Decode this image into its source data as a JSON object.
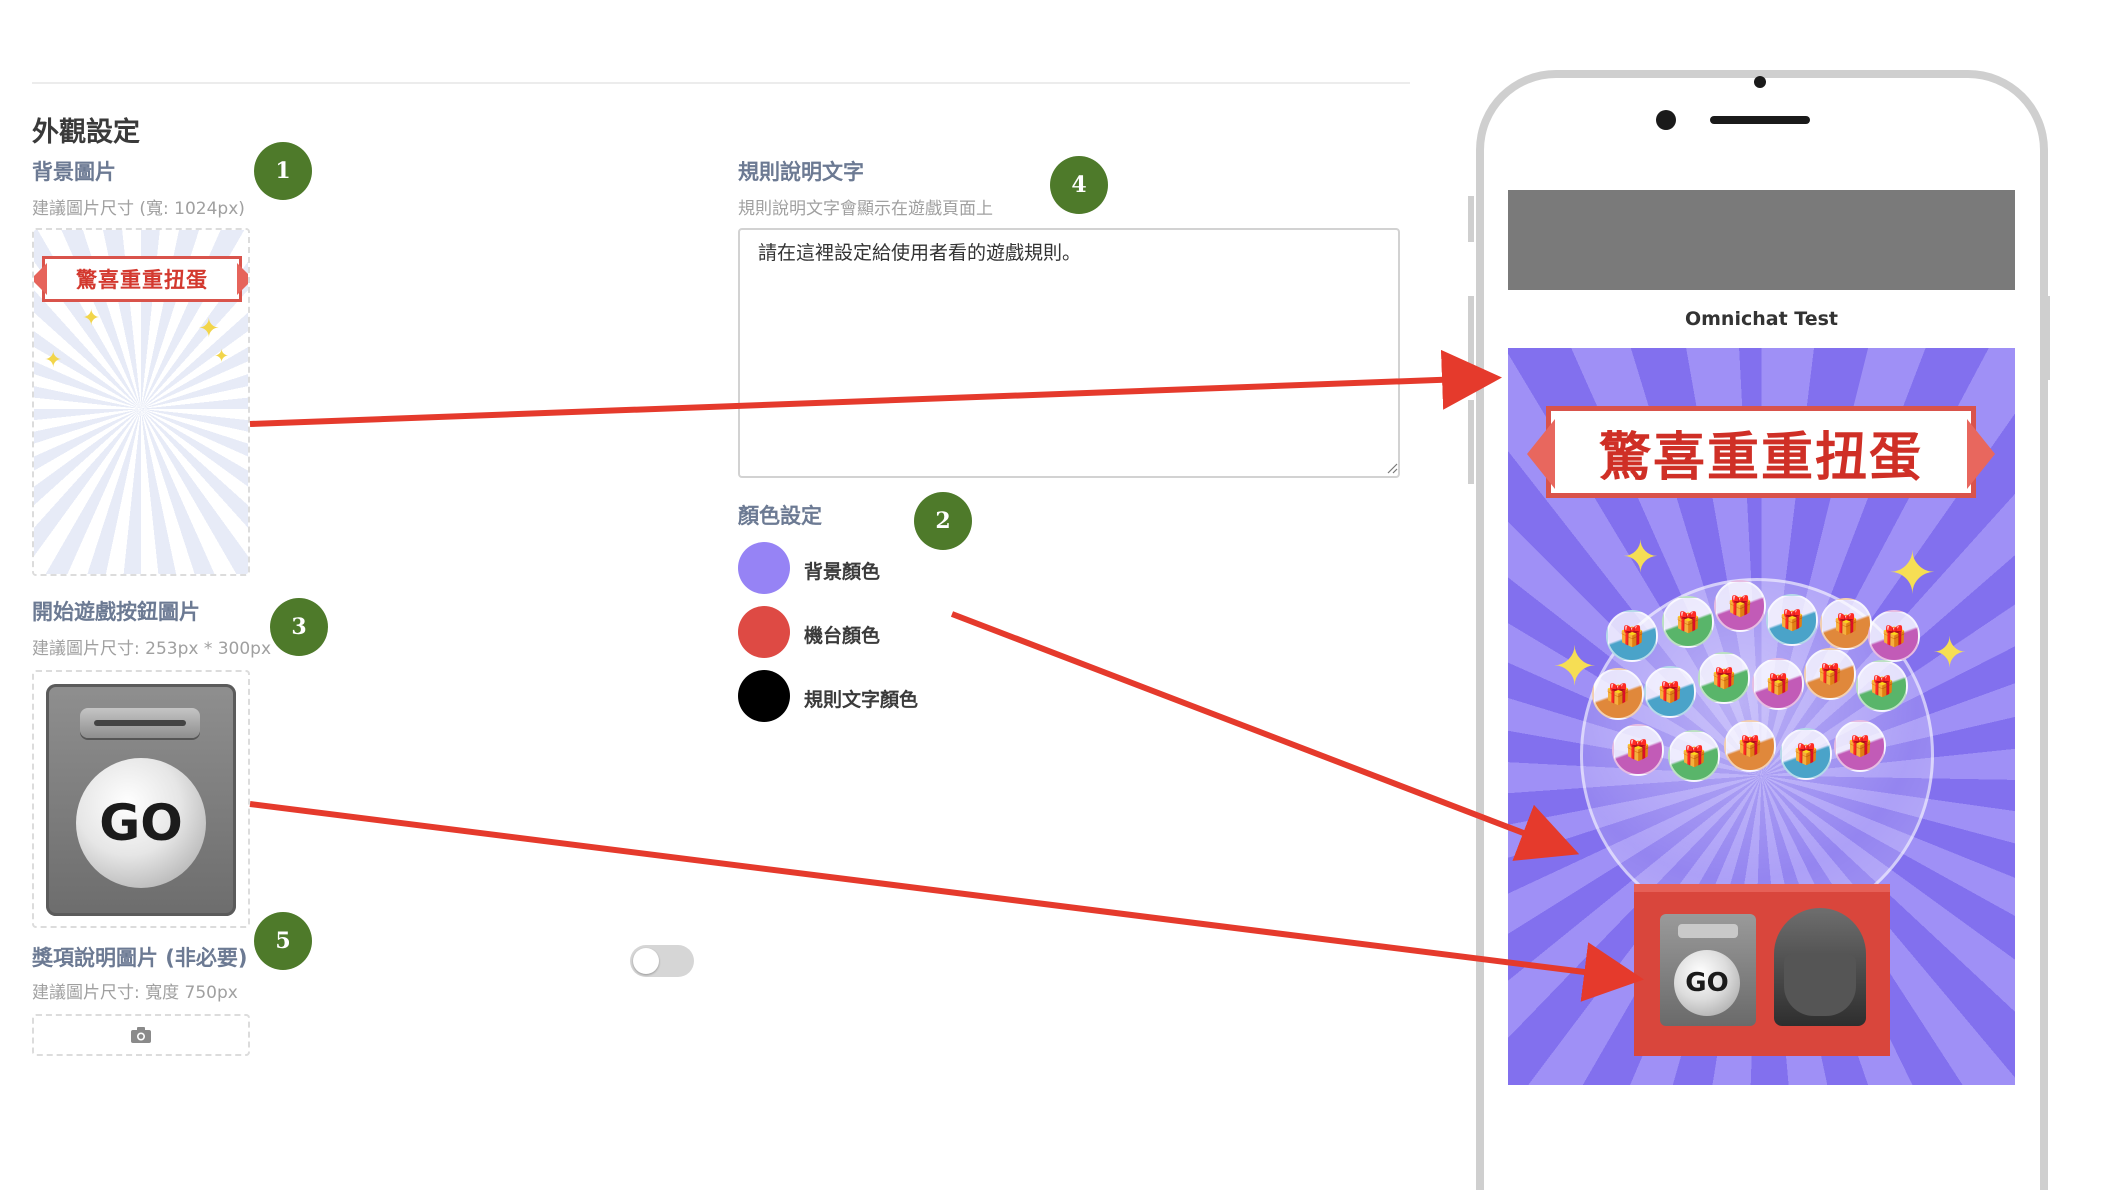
{
  "section_title": "外觀設定",
  "background_image": {
    "label": "背景圖片",
    "hint": "建議圖片尺寸 (寬: 1024px)",
    "badge": "1",
    "thumb_banner": "驚喜重重扭蛋"
  },
  "start_button_image": {
    "label": "開始遊戲按鈕圖片",
    "hint": "建議圖片尺寸: 253px * 300px",
    "badge": "3",
    "go_text": "GO"
  },
  "prize_image": {
    "label": "獎項說明圖片 (非必要)",
    "hint": "建議圖片尺寸: 寬度 750px",
    "badge": "5",
    "toggle_on": false
  },
  "rules_text": {
    "label": "規則說明文字",
    "hint": "規則說明文字會顯示在遊戲頁面上",
    "badge": "4",
    "value": "請在這裡設定給使用者看的遊戲規則。"
  },
  "color_settings": {
    "label": "顏色設定",
    "badge": "2",
    "items": [
      {
        "label": "背景顏色",
        "color": "#9683f5"
      },
      {
        "label": "機台顏色",
        "color": "#de4a44"
      },
      {
        "label": "規則文字顏色",
        "color": "#000000"
      }
    ]
  },
  "phone_preview": {
    "title": "Omnichat Test",
    "banner": "驚喜重重扭蛋",
    "go_text": "GO",
    "capsule_glyph": "🎁"
  },
  "colors": {
    "badge": "#4e7a2a",
    "arrow": "#e53a2c",
    "label": "#6c7a93"
  }
}
